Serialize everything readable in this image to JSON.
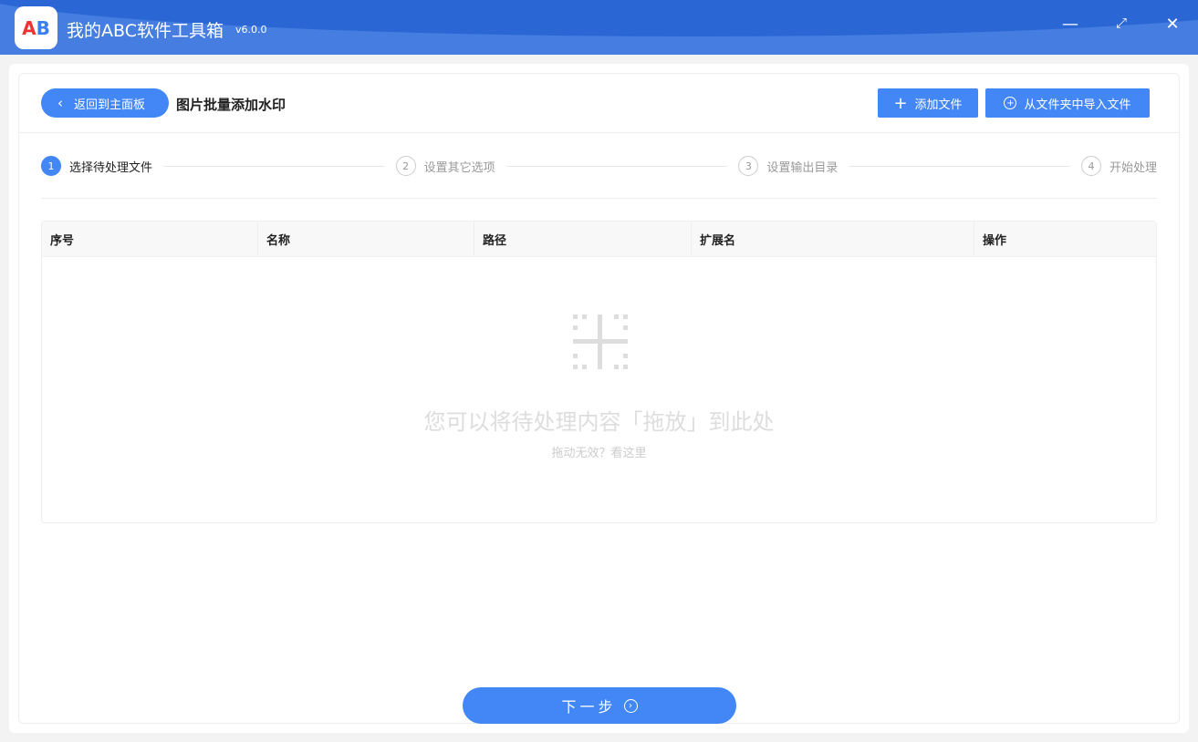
{
  "app": {
    "title": "我的ABC软件工具箱",
    "version": "v6.0.0",
    "logo_text": "AB"
  },
  "header": {
    "back_label": "返回到主面板",
    "page_title": "图片批量添加水印",
    "add_file": "添加文件",
    "import_folder": "从文件夹中导入文件"
  },
  "steps": [
    {
      "num": "1",
      "label": "选择待处理文件"
    },
    {
      "num": "2",
      "label": "设置其它选项"
    },
    {
      "num": "3",
      "label": "设置输出目录"
    },
    {
      "num": "4",
      "label": "开始处理"
    }
  ],
  "table": {
    "columns": [
      "序号",
      "名称",
      "路径",
      "扩展名",
      "操作"
    ]
  },
  "empty": {
    "message": "您可以将待处理内容「拖放」到此处",
    "hint": "拖动无效？看这里"
  },
  "footer": {
    "next_label": "下一步"
  }
}
